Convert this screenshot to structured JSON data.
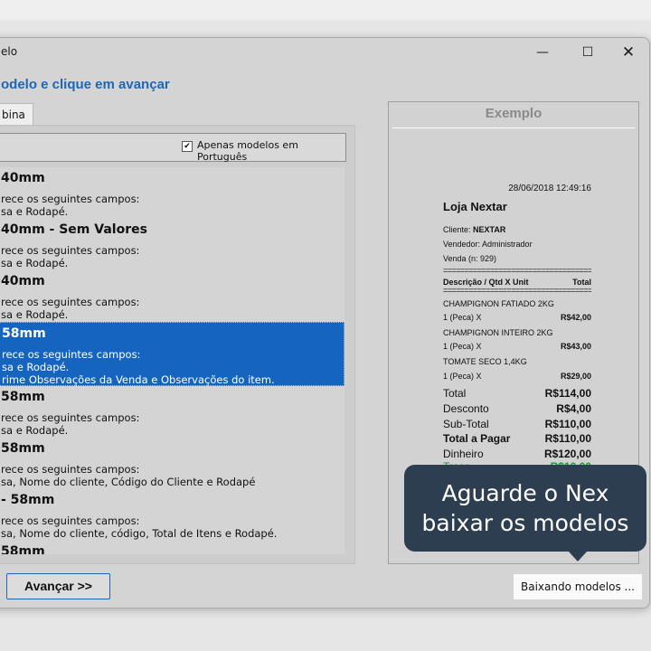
{
  "window": {
    "title": "elo",
    "minimize": "—",
    "maximize": "☐",
    "close": "✕"
  },
  "heading": "odelo e clique em avançar",
  "tab_label": "bina",
  "filter": {
    "checked": "✔",
    "label": "Apenas modelos em Português"
  },
  "models": [
    {
      "title": "40mm",
      "lines": [
        "rece os seguintes campos:",
        "sa e Rodapé."
      ]
    },
    {
      "title": "40mm - Sem Valores",
      "lines": [
        "rece os seguintes campos:",
        "sa e Rodapé."
      ]
    },
    {
      "title": "40mm",
      "lines": [
        "rece os seguintes campos:",
        "sa e Rodapé."
      ]
    },
    {
      "title": "58mm",
      "lines": [
        "rece os seguintes campos:",
        "sa e Rodapé.",
        "rime Observações da Venda e Observações do item."
      ],
      "selected": true
    },
    {
      "title": "58mm",
      "lines": [
        "rece os seguintes campos:",
        "sa e Rodapé."
      ]
    },
    {
      "title": "58mm",
      "lines": [
        "rece os seguintes campos:",
        "sa, Nome do cliente, Código do Cliente e Rodapé"
      ]
    },
    {
      "title": "- 58mm",
      "lines": [
        "rece os seguintes campos:",
        "sa, Nome do cliente, código, Total de Itens e Rodapé."
      ]
    },
    {
      "title": "58mm",
      "lines": []
    }
  ],
  "next_button": "Avançar >>",
  "example": {
    "title": "Exemplo",
    "receipt": {
      "datetime": "28/06/2018 12:49:16",
      "store": "Loja Nextar",
      "client_label": "Cliente:",
      "client_value": "NEXTAR",
      "seller": "Vendedor: Administrador",
      "sale": "Venda (n: 929)",
      "separator": "=======================================",
      "header_left": "Descrição / Qtd X Unit",
      "header_right": "Total",
      "items": [
        {
          "name": "CHAMPIGNON FATIADO 2KG",
          "qty": "1 (Peca) X",
          "price": "R$42,00"
        },
        {
          "name": "CHAMPIGNON INTEIRO 2KG",
          "qty": "1 (Peca) X",
          "price": "R$43,00"
        },
        {
          "name": "TOMATE SECO 1,4KG",
          "qty": "1 (Peca) X",
          "price": "R$29,00"
        }
      ],
      "totals": [
        {
          "label": "Total",
          "value": "R$114,00"
        },
        {
          "label": "Desconto",
          "value": "R$4,00"
        },
        {
          "label": "Sub-Total",
          "value": "R$110,00"
        },
        {
          "label": "Total a Pagar",
          "value": "R$110,00"
        },
        {
          "label": "Dinheiro",
          "value": "R$120,00"
        },
        {
          "label": "Troco",
          "value": "R$10,00"
        }
      ]
    }
  },
  "tooltip": "Aguarde o Nex baixar os modelos",
  "status": "Baixando modelos ...",
  "colors": {
    "accent": "#1f66b5",
    "selection": "#1565c0",
    "tooltip_bg": "#2c3e50",
    "change_green": "#1a9a3a"
  }
}
